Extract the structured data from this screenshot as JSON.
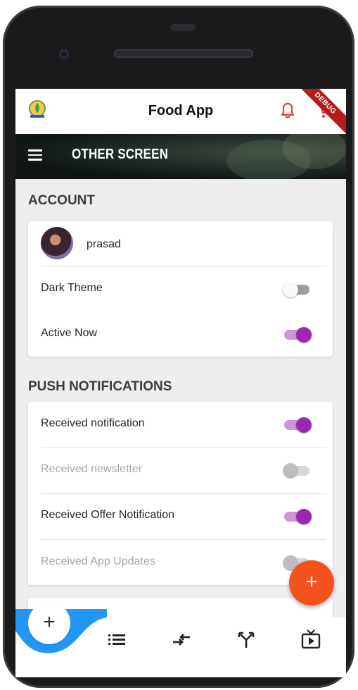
{
  "app": {
    "title": "Food App",
    "debug_label": "DEBUG"
  },
  "header": {
    "screen_title": "OTHER SCREEN"
  },
  "account": {
    "title": "ACCOUNT",
    "user_name": "prasad",
    "dark_theme": {
      "label": "Dark Theme",
      "on": false,
      "enabled": true
    },
    "active_now": {
      "label": "Active Now",
      "on": true,
      "enabled": true
    }
  },
  "notifications": {
    "title": "PUSH NOTIFICATIONS",
    "items": [
      {
        "label": "Received notification",
        "on": true,
        "enabled": true
      },
      {
        "label": "Received newsletter",
        "on": false,
        "enabled": false
      },
      {
        "label": "Received Offer Notification",
        "on": true,
        "enabled": true
      },
      {
        "label": "Received App Updates",
        "on": false,
        "enabled": false
      }
    ]
  },
  "fab": {
    "label": "+"
  },
  "bottom_nav": {
    "add_label": "+",
    "icons": [
      "list-icon",
      "compare-arrows-icon",
      "call-split-icon",
      "live-tv-icon"
    ]
  },
  "colors": {
    "accent": "#9c27b0",
    "accent_light": "#ce93d8",
    "fab": "#f4511e",
    "nav_curve": "#2196f3",
    "alert": "#e53935"
  }
}
